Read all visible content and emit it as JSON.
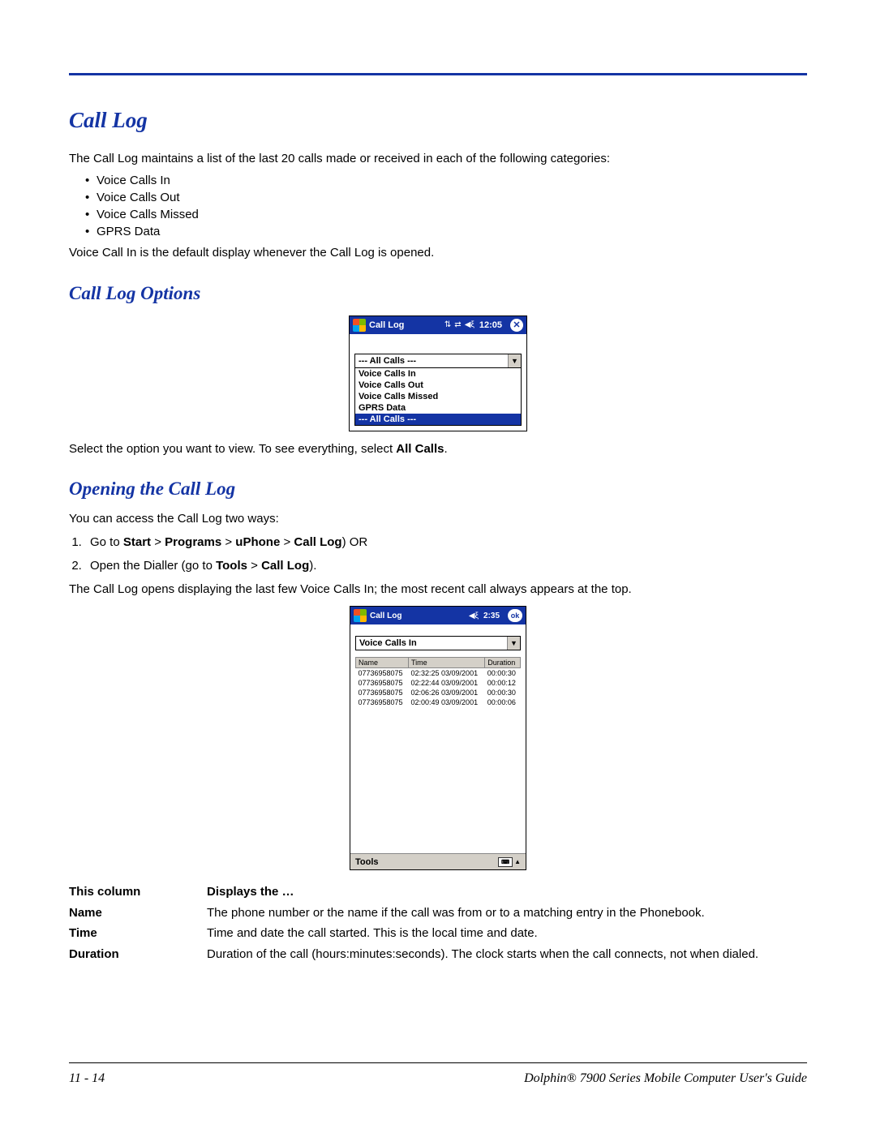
{
  "headings": {
    "h1": "Call Log",
    "h2a": "Call Log Options",
    "h2b": "Opening the Call Log"
  },
  "intro": "The Call Log maintains a list of the last 20 calls made or received in each of the following categories:",
  "bullets": [
    "Voice Calls In",
    "Voice Calls Out",
    "Voice Calls Missed",
    "GPRS Data"
  ],
  "default_note": "Voice Call In is the default display whenever the Call Log is opened.",
  "select_note_pre": "Select the option you want to view. To see everything, select ",
  "select_note_bold": "All Calls",
  "select_note_post": ".",
  "access_intro": "You can access the Call Log two ways:",
  "step1": {
    "pre": "Go to ",
    "b1": "Start",
    "gt1": " > ",
    "b2": "Programs",
    "gt2": " > ",
    "b3": "uPhone",
    "gt3": " > ",
    "b4": "Call Log",
    "post": ") OR"
  },
  "step2": {
    "pre": "Open the Dialler (go to ",
    "b1": "Tools",
    "gt": " > ",
    "b2": "Call Log",
    "post": ")."
  },
  "opens_note": "The Call Log opens displaying the last few Voice Calls In; the most recent call always appears at the top.",
  "shot1": {
    "title": "Call Log",
    "time": "12:05",
    "combo": "--- All Calls ---",
    "items": [
      "Voice Calls In",
      "Voice Calls Out",
      "Voice Calls Missed",
      "GPRS Data"
    ],
    "selected": "--- All Calls ---"
  },
  "shot2": {
    "title": "Call Log",
    "time": "2:35",
    "ok": "ok",
    "combo": "Voice Calls In",
    "headers": [
      "Name",
      "Time",
      "Duration"
    ],
    "rows": [
      {
        "name": "07736958075",
        "time": "02:32:25 03/09/2001",
        "dur": "00:00:30"
      },
      {
        "name": "07736958075",
        "time": "02:22:44 03/09/2001",
        "dur": "00:00:12"
      },
      {
        "name": "07736958075",
        "time": "02:06:26 03/09/2001",
        "dur": "00:00:30"
      },
      {
        "name": "07736958075",
        "time": "02:00:49 03/09/2001",
        "dur": "00:00:06"
      }
    ],
    "footer": "Tools"
  },
  "coltable": {
    "head": [
      "This column",
      "Displays the …"
    ],
    "rows": [
      {
        "c1": "Name",
        "c2": "The phone number or the name if the call was from or to a matching entry in the Phonebook."
      },
      {
        "c1": "Time",
        "c2": "Time and date the call started. This is the local time and date."
      },
      {
        "c1": "Duration",
        "c2": "Duration of the call (hours:minutes:seconds). The clock starts when the call connects, not when dialed."
      }
    ]
  },
  "footer": {
    "left": "11 - 14",
    "right": "Dolphin® 7900 Series Mobile Computer User's Guide"
  }
}
